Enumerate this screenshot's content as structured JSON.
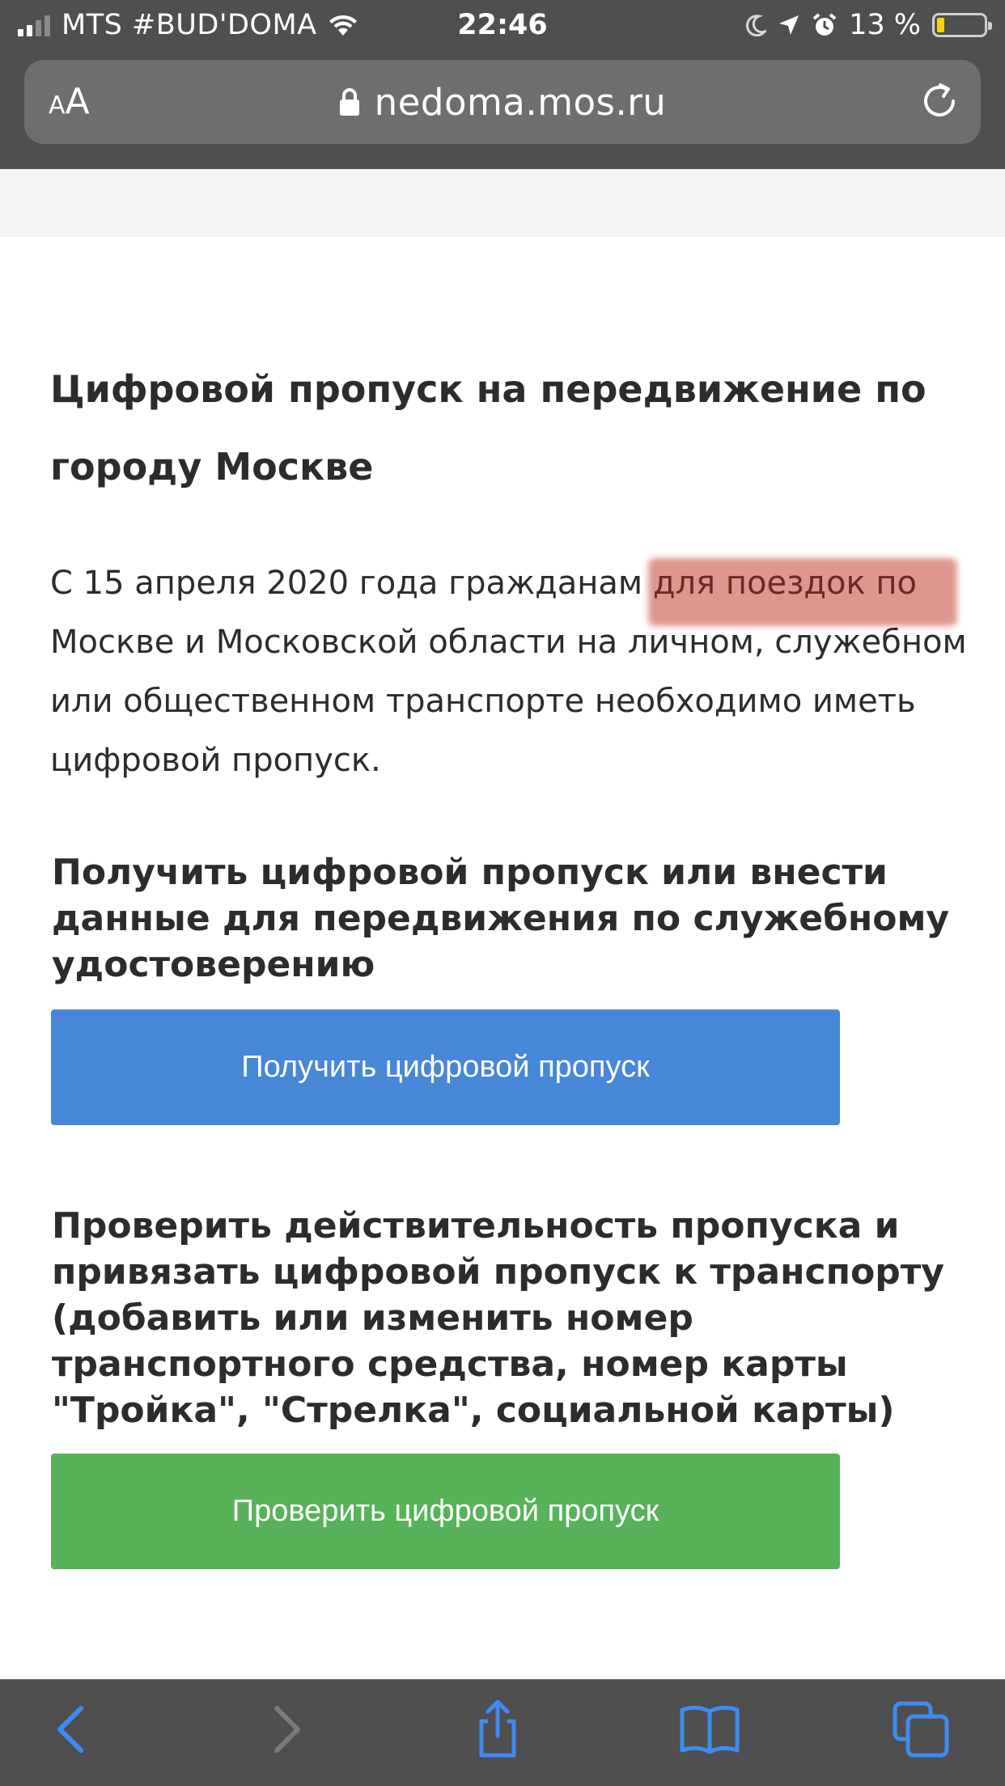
{
  "status_bar": {
    "carrier": "MTS #BUD'DOMA",
    "time": "22:46",
    "battery_percent": "13 %",
    "signal_bars_active": 2,
    "signal_bars_total": 4,
    "battery_level": 0.13,
    "battery_color": "#f5d60a"
  },
  "browser": {
    "text_size_label": "AA",
    "url": "nedoma.mos.ru"
  },
  "page": {
    "title": "Цифровой пропуск на передвижение по городу Москве",
    "intro_before": "С 15 апреля 2020 года гражданам ",
    "intro_highlight": "для поездок по",
    "intro_after": " Москве и Московской области на личном, служебном или общественном транспорте необходимо иметь цифровой пропуск.",
    "section_get_heading": "Получить цифровой пропуск или внести данные для передвижения по служебному удостоверению",
    "get_button_label": "Получить цифровой пропуск",
    "section_check_heading": "Проверить действительность пропуска и привязать цифровой пропуск к транспорту (добавить или изменить номер транспортного средства, номер карты \"Тройка\", \"Стрелка\", социальной карты)",
    "check_button_label": "Проверить цифровой пропуск"
  },
  "colors": {
    "primary_button": "#4787d8",
    "secondary_button": "#58b25a",
    "chrome": "#4f4f4f",
    "toolbar_icon": "#3f8bf0",
    "highlight": "#cd5f50"
  },
  "toolbar": {
    "icons": [
      "back-icon",
      "forward-icon",
      "share-icon",
      "bookmarks-icon",
      "tabs-icon"
    ]
  }
}
